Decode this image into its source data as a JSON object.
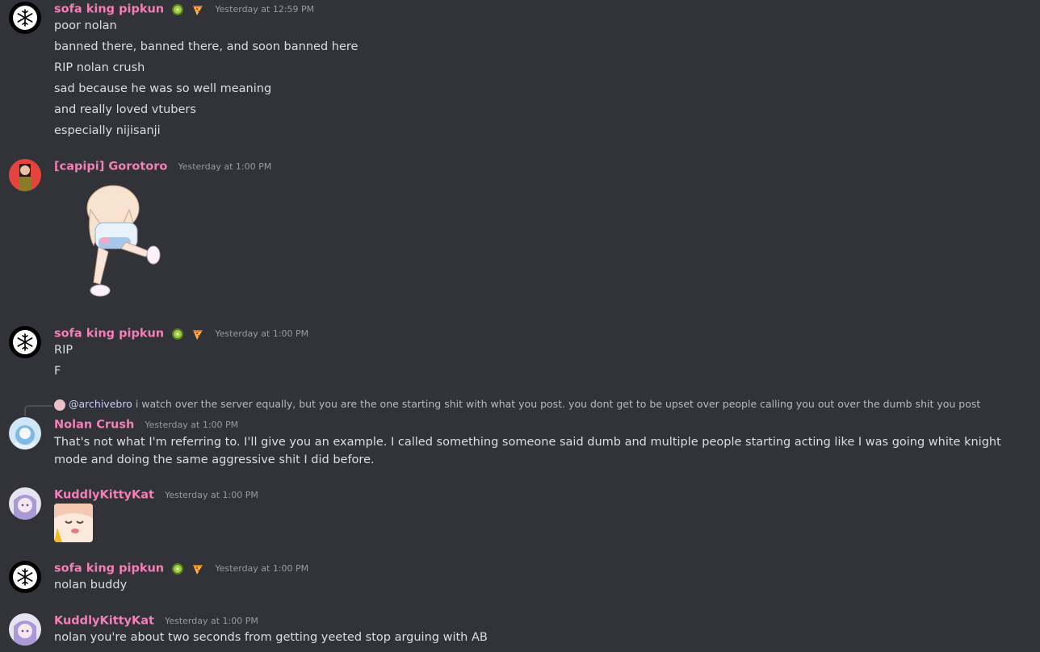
{
  "messages": [
    {
      "author": "sofa king pipkun",
      "timestamp": "Yesterday at 12:59 PM",
      "lines": [
        "poor nolan",
        "banned there, banned there, and soon banned here",
        "RIP nolan crush",
        "sad because he was so well meaning",
        "and really loved vtubers",
        "especially nijisanji"
      ]
    },
    {
      "author": "[capipi] Gorotoro",
      "timestamp": "Yesterday at 1:00 PM"
    },
    {
      "author": "sofa king pipkun",
      "timestamp": "Yesterday at 1:00 PM",
      "lines": [
        "RIP",
        "F"
      ]
    },
    {
      "reply": {
        "mention": "@archivebro",
        "text": "i watch over the server equally, but you are the one starting shit with what you post. you dont get to be upset over people calling you out over the dumb shit you post"
      },
      "author": "Nolan Crush",
      "timestamp": "Yesterday at 1:00 PM",
      "lines": [
        "That's not what I'm referring to. I'll give you an example. I called something someone said  dumb and multiple people starting acting like I was going white knight mode and doing the same aggressive shit I did before."
      ]
    },
    {
      "author": "KuddlyKittyKat",
      "timestamp": "Yesterday at 1:00 PM"
    },
    {
      "author": "sofa king pipkun",
      "timestamp": "Yesterday at 1:00 PM",
      "lines": [
        "nolan buddy"
      ]
    },
    {
      "author": "KuddlyKittyKat",
      "timestamp": "Yesterday at 1:00 PM",
      "lines": [
        "nolan you're about two seconds from getting yeeted stop arguing with AB"
      ]
    }
  ],
  "colors": {
    "background": "#313338",
    "username": "#f47fb8",
    "text": "#dbdee1",
    "timestamp": "#949ba4"
  },
  "icons": [
    "snowflake-avatar-icon",
    "kiwi-badge-icon",
    "pizza-badge-icon",
    "reply-spine-icon"
  ]
}
